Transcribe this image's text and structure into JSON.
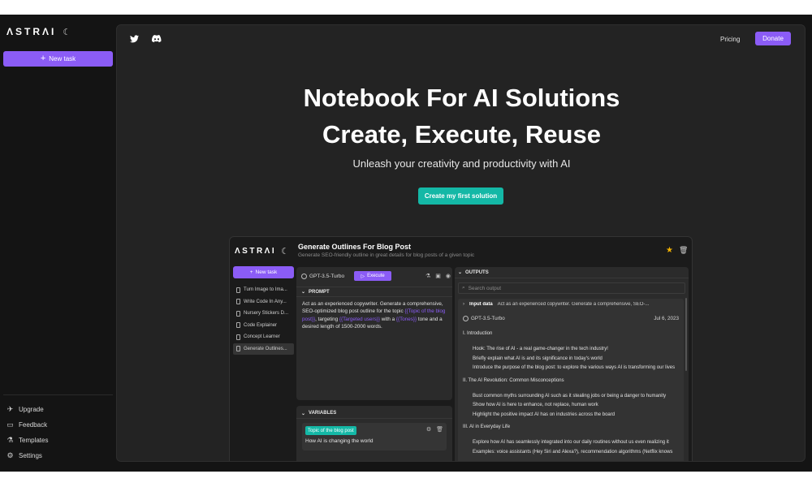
{
  "sidebar": {
    "logo": "ΛSTRΛI",
    "new_task": "New task",
    "bottom": [
      {
        "label": "Upgrade",
        "icon": "rocket-icon",
        "glyph": "✈"
      },
      {
        "label": "Feedback",
        "icon": "chat-icon",
        "glyph": "▭"
      },
      {
        "label": "Templates",
        "icon": "flask-icon",
        "glyph": "⚗"
      },
      {
        "label": "Settings",
        "icon": "gear-icon",
        "glyph": "⚙"
      }
    ]
  },
  "topbar": {
    "pricing": "Pricing",
    "donate": "Donate"
  },
  "hero": {
    "line1": "Notebook For AI Solutions",
    "line2": "Create, Execute, Reuse",
    "subtitle": "Unleash your creativity and productivity with AI",
    "cta": "Create my first solution"
  },
  "preview": {
    "logo": "ΛSTRΛI",
    "title": "Generate Outlines For Blog Post",
    "subtitle": "Generate SEO-friendly outline in great details for blog posts of a given topic",
    "new_task": "New task",
    "tasks": [
      "Turn Image to Ima...",
      "Write Code In Any...",
      "Nursery Stickers D...",
      "Code Explainer",
      "Concept Learner",
      "Generate Outlines..."
    ],
    "model": "GPT-3.5-Turbo",
    "execute": "Execute",
    "prompt_header": "PROMPT",
    "prompt": {
      "p1": "Act as an experienced copywriter. Generate a comprehensive, SEO-optimized blog post outline for the topic ",
      "v1": "{{Topic of the blog post}}",
      "p2": ", targeting ",
      "v2": "{{Targeted users}}",
      "p3": " with a ",
      "v3": "{{Tones}}",
      "p4": " tone and a desired length of 1500-2000 words."
    },
    "variables_header": "VARIABLES",
    "variable_tag": "Topic of the blog post",
    "variable_value": "How AI is changing the world",
    "outputs_header": "OUTPUTS",
    "search_placeholder": "Search output",
    "input_data_label": "Input data",
    "input_data_text": "Act as an experienced copywriter. Generate a comprehensive, SEO-...",
    "output_model": "GPT-3.5-Turbo",
    "output_date": "Jul 6, 2023",
    "sections": [
      {
        "heading": "I. Introduction",
        "bullets": [
          "Hook: The rise of AI - a real game-changer in the tech industry!",
          "Briefly explain what AI is and its significance in today's world",
          "Introduce the purpose of the blog post: to explore the various ways AI is transforming our lives"
        ]
      },
      {
        "heading": "II. The AI Revolution: Common Misconceptions",
        "bullets": [
          "Bust common myths surrounding AI such as it stealing jobs or being a danger to humanity",
          "Show how AI is here to enhance, not replace, human work",
          "Highlight the positive impact AI has on industries across the board"
        ]
      },
      {
        "heading": "III. AI in Everyday Life",
        "bullets": [
          "Explore how AI has seamlessly integrated into our daily routines without us even realizing it",
          "Examples: voice assistants (Hey Siri and Alexa?), recommendation algorithms (Netflix knows"
        ]
      }
    ]
  }
}
